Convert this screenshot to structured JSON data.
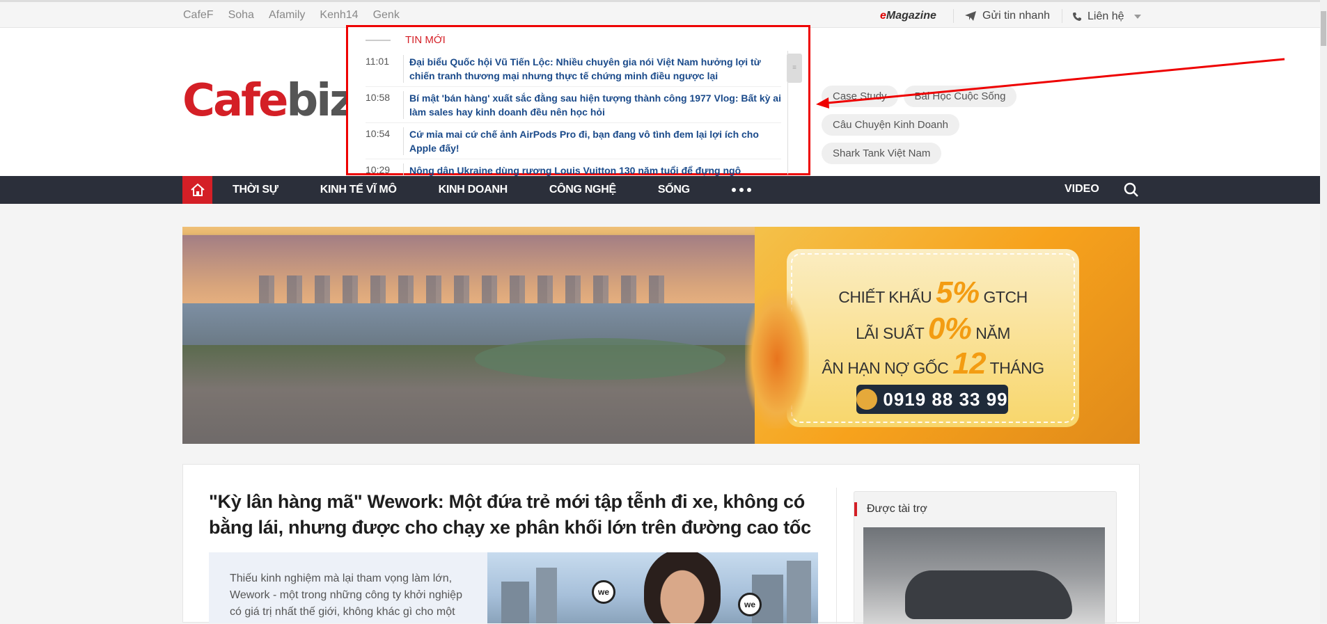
{
  "topbar": {
    "links": [
      "CafeF",
      "Soha",
      "Afamily",
      "Kenh14",
      "Genk"
    ],
    "emagazine_prefix": "e",
    "emagazine_rest": "Magazine",
    "send_news": "Gửi tin nhanh",
    "contact": "Liên hệ"
  },
  "logo": {
    "part1": "Cafe",
    "part2": "biz"
  },
  "tags": [
    "Case Study",
    "Bài Học Cuộc Sống",
    "Câu Chuyện Kinh Doanh",
    "Shark Tank Việt Nam"
  ],
  "latest_news": {
    "title": "TIN MỚI",
    "items": [
      {
        "time": "11:01",
        "headline": "Đại biểu Quốc hội Vũ Tiến Lộc: Nhiều chuyên gia nói Việt Nam hưởng lợi từ chiến tranh thương mại nhưng thực tế chứng minh điều ngược lại"
      },
      {
        "time": "10:58",
        "headline": "Bí mật 'bán hàng' xuất sắc đằng sau hiện tượng thành công 1977 Vlog: Bất kỳ ai làm sales hay kinh doanh đều nên học hỏi"
      },
      {
        "time": "10:54",
        "headline": "Cứ mỉa mai cứ chế ảnh AirPods Pro đi, bạn đang vô tình đem lại lợi ích cho Apple đấy!"
      },
      {
        "time": "10:29",
        "headline": "Nông dân Ukraine dùng rương Louis Vuitton 130 năm tuổi để đựng ngô"
      }
    ]
  },
  "nav": {
    "items": [
      "THỜI SỰ",
      "KINH TẾ VĨ MÔ",
      "KINH DOANH",
      "CÔNG NGHỆ",
      "SỐNG"
    ],
    "video": "VIDEO"
  },
  "banner": {
    "line1_pre": "CHIẾT KHẤU",
    "line1_big": "5%",
    "line1_post": "GTCH",
    "line2_pre": "LÃI SUẤT",
    "line2_big": "0%",
    "line2_post": "NĂM",
    "line3_pre": "ÂN HẠN NỢ GỐC",
    "line3_big": "12",
    "line3_post": "THÁNG",
    "phone": "0919 88 33 99"
  },
  "article": {
    "title": "\"Kỳ lân hàng mã\" Wework: Một đứa trẻ mới tập tễnh đi xe, không có bằng lái, nhưng được cho chạy xe phân khối lớn trên đường cao tốc",
    "sapo": "Thiếu kinh nghiệm mà lại tham vọng làm lớn, Wework - một trong những công ty khởi nghiệp có giá trị nhất thế giới, không khác gì cho một"
  },
  "sponsor": {
    "title": "Được tài trợ"
  },
  "colors": {
    "brand_red": "#d41f26",
    "nav_bg": "#2b2f3a",
    "headline_blue": "#1a4a8a"
  }
}
